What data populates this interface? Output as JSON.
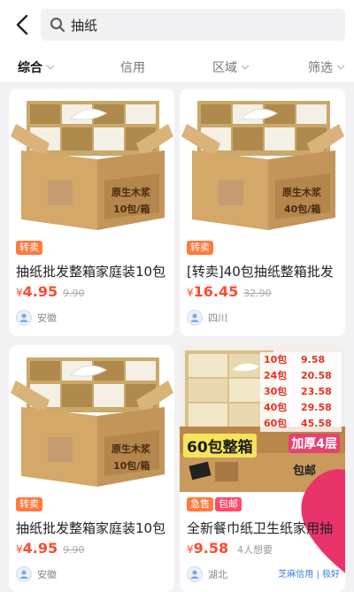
{
  "search": {
    "query": "抽纸"
  },
  "filters": [
    {
      "label": "综合"
    },
    {
      "label": "信用"
    },
    {
      "label": "区域"
    },
    {
      "label": "筛选"
    }
  ],
  "products": [
    {
      "tags": [
        "转卖"
      ],
      "title": "抽纸批发整箱家庭装10包",
      "currency": "¥",
      "price": "4.95",
      "original_price": "9.90",
      "location": "安徽",
      "box_labels": [
        "原生木浆",
        "10包/箱"
      ]
    },
    {
      "tags": [
        "转卖"
      ],
      "title": "[转卖]40包抽纸整箱批发",
      "currency": "¥",
      "price": "16.45",
      "original_price": "32.90",
      "location": "四川",
      "box_labels": [
        "原生木浆",
        "40包/箱"
      ]
    },
    {
      "tags": [
        "转卖"
      ],
      "title": "抽纸批发整箱家庭装10包",
      "currency": "¥",
      "price": "4.95",
      "original_price": "9.90",
      "location": "安徽",
      "box_labels": [
        "原生木浆",
        "10包/箱"
      ]
    },
    {
      "tags": [
        "急售",
        "包邮"
      ],
      "title": "全新餐巾纸卫生纸家用抽",
      "currency": "¥",
      "price": "9.58",
      "want_count": "4人想要",
      "location": "湖北",
      "credit": "芝麻信用 | 极好",
      "price_list": [
        {
          "qty": "10包",
          "price": "9.58"
        },
        {
          "qty": "24包",
          "price": "20.58"
        },
        {
          "qty": "30包",
          "price": "23.58"
        },
        {
          "qty": "40包",
          "price": "29.58"
        },
        {
          "qty": "60包",
          "price": "45.58"
        }
      ],
      "banner": "60包整箱",
      "thick_label": "加厚4层",
      "badge": "包邮"
    }
  ]
}
